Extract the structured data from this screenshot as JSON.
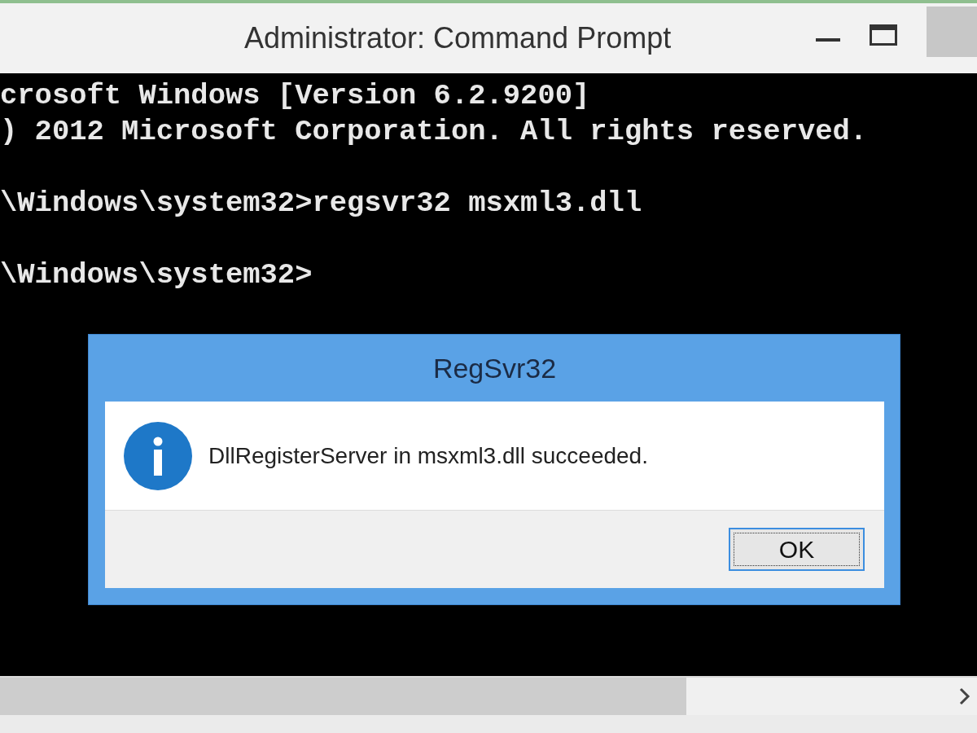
{
  "window": {
    "title": "Administrator: Command Prompt"
  },
  "console": {
    "blocks": [
      [
        "crosoft Windows [Version 6.2.9200]",
        ") 2012 Microsoft Corporation. All rights reserved."
      ],
      [
        "\\Windows\\system32>regsvr32 msxml3.dll"
      ],
      [
        "\\Windows\\system32>"
      ]
    ]
  },
  "dialog": {
    "title": "RegSvr32",
    "message": "DllRegisterServer in msxml3.dll succeeded.",
    "button": "OK"
  }
}
